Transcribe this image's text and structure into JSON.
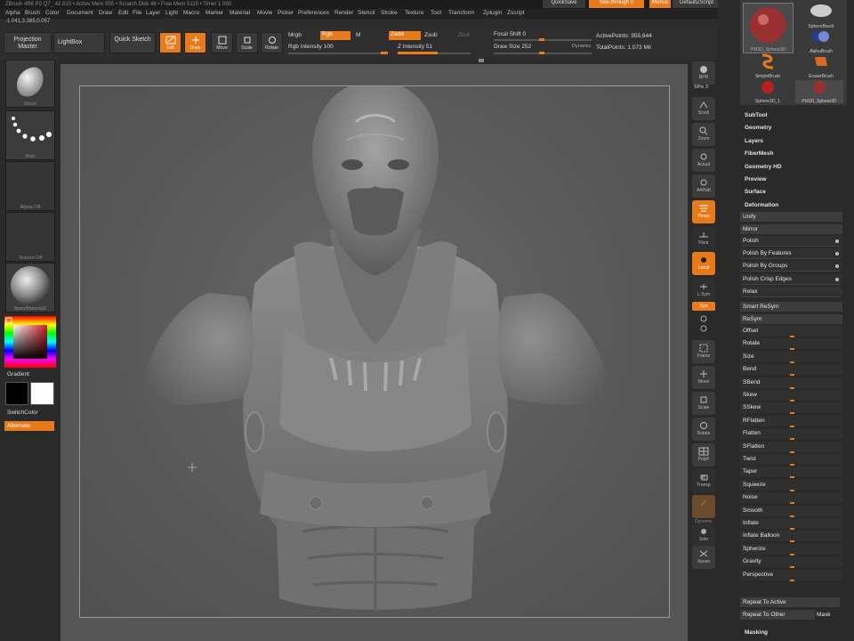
{
  "title_bar": {
    "text": "ZBrush 4R6 P2   Q7_ 42.810   • Active Mem 955 • Scratch Disk 48 • Free Mem 5115 • Timer 1.080",
    "quicksave": "QuickSave",
    "see_through": "See-through 0",
    "menus": "Menus",
    "default_zscript": "DefaultZScript"
  },
  "menu_bar": [
    "Alpha",
    "Brush",
    "Color",
    "Document",
    "Draw",
    "Edit",
    "File",
    "Layer",
    "Light",
    "Macro",
    "Marker",
    "Material",
    "Movie",
    "Picker",
    "Preferences",
    "Render",
    "Stencil",
    "Stroke",
    "Texture",
    "Tool",
    "Transform",
    "Zplugin",
    "Zscript"
  ],
  "coords": "-1.041,3.385,0.057",
  "toolbar": {
    "projection_master": "Projection Master",
    "lightbox": "LightBox",
    "quick_sketch": "Quick Sketch",
    "edit": "Edit",
    "draw": "Draw",
    "move": "Move",
    "scale": "Scale",
    "rotate": "Rotate",
    "mrgb": "Mrgb",
    "rgb": "Rgb",
    "m": "M",
    "zadd": "Zadd",
    "zsub": "Zsub",
    "zcut": "Zcut",
    "rgb_intensity": "Rgb Intensity 100",
    "z_intensity": "Z Intensity 51",
    "focal_shift": "Focal Shift 0",
    "draw_size": "Draw Size 252",
    "dynamic": "Dynamic",
    "active_points": "ActivePoints: 955,644",
    "total_points": "TotalPoints: 1.073 Mil"
  },
  "left_panel": {
    "move_brush": "Move",
    "dots_stroke": "Dots",
    "alpha": "Alpha Off",
    "texture": "Texture Off",
    "material": "BasicMaterial2",
    "gradient": "Gradient",
    "switch_color": "SwitchColor",
    "alternate": "Alternate"
  },
  "shelf": [
    {
      "label": "BPR",
      "icon": "bpr-icon"
    },
    {
      "label": "SPix 3",
      "icon": ""
    },
    {
      "label": "Scroll",
      "icon": "scroll-icon"
    },
    {
      "label": "Zoom",
      "icon": "zoom-icon"
    },
    {
      "label": "Actual",
      "icon": "actual-icon"
    },
    {
      "label": "AAHalf",
      "icon": "aahalf-icon"
    },
    {
      "label": "Persp",
      "icon": "persp-icon"
    },
    {
      "label": "Floor",
      "icon": "floor-icon"
    },
    {
      "label": "Local",
      "icon": "local-icon"
    },
    {
      "label": "L.Sym",
      "icon": "lsym-icon"
    },
    {
      "label": "Xyz",
      "icon": "xyz-icon"
    },
    {
      "label": "Frame",
      "icon": "frame-icon"
    },
    {
      "label": "Move",
      "icon": "move-icon"
    },
    {
      "label": "Scale",
      "icon": "scale-icon"
    },
    {
      "label": "Rotate",
      "icon": "rotate-icon"
    },
    {
      "label": "PolyF",
      "icon": "polyf-icon"
    },
    {
      "label": "Transp",
      "icon": "transp-icon"
    },
    {
      "label": "Dynamic",
      "icon": "ghost-icon"
    },
    {
      "label": "Solo",
      "icon": "solo-icon"
    },
    {
      "label": "Xpose",
      "icon": "xpose-icon"
    }
  ],
  "tool_tray": {
    "brushes": [
      "PM3D_Sphere3D",
      "SphereBrush",
      "AlphaBrush",
      "SimpleBrush",
      "EraserBrush",
      "Sphere3D_1",
      "PM3D_Sphere3D"
    ],
    "sections": [
      "SubTool",
      "Geometry",
      "Layers",
      "FiberMesh",
      "Geometry HD",
      "Preview",
      "Surface",
      "Deformation"
    ],
    "unify": "Unify",
    "mirror": "Mirror",
    "polish_rows": [
      "Polish",
      "Polish By Features",
      "Polish By Groups",
      "Polish Crisp Edges",
      "Relax"
    ],
    "smart_resym": "Smart ReSym",
    "resym": "ReSym",
    "deform_sliders": [
      "Offset",
      "Rotate",
      "Size",
      "Bend",
      "SBend",
      "Skew",
      "SSkew",
      "RFlatten",
      "Flatten",
      "SFlatten",
      "Twist",
      "Taper",
      "Squeeze",
      "Noise",
      "Smooth",
      "Inflate",
      "Inflate Balloon",
      "Spherize",
      "Gravity",
      "Perspective"
    ],
    "repeat_to_active": "Repeat To Active",
    "repeat_to_other": "Repeat To Other",
    "mask": "Mask",
    "masking": "Masking"
  },
  "colors": {
    "accent": "#e97a1a",
    "panel": "#2a2a2a",
    "viewport": "#5c5c5d"
  }
}
